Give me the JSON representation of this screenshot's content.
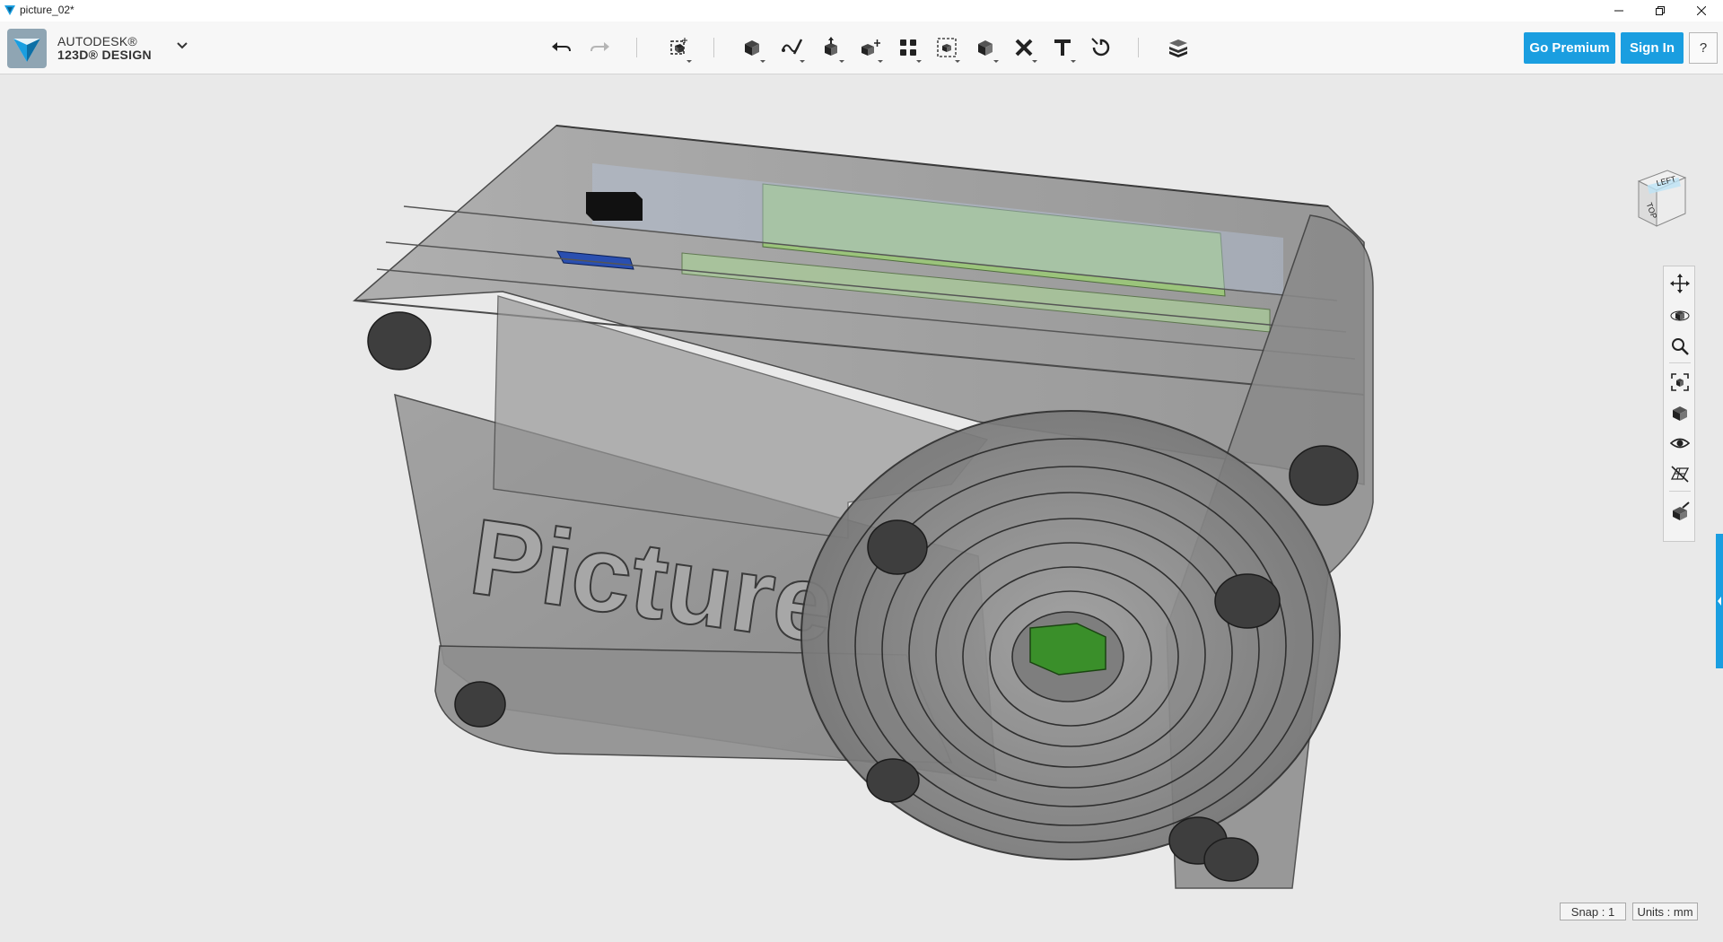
{
  "window": {
    "title": "picture_02*"
  },
  "brand": {
    "line1": "AUTODESK®",
    "line2": "123D® DESIGN"
  },
  "toolbar": {
    "tools": [
      {
        "name": "undo-icon"
      },
      {
        "name": "redo-icon"
      },
      {
        "name": "transform-icon"
      },
      {
        "name": "primitives-icon"
      },
      {
        "name": "sketch-icon"
      },
      {
        "name": "construct-icon"
      },
      {
        "name": "modify-icon"
      },
      {
        "name": "pattern-icon"
      },
      {
        "name": "group-icon"
      },
      {
        "name": "combine-icon"
      },
      {
        "name": "measure-icon"
      },
      {
        "name": "text-icon"
      },
      {
        "name": "snap-icon"
      },
      {
        "name": "material-icon"
      }
    ]
  },
  "buttons": {
    "premium": "Go Premium",
    "signin": "Sign In",
    "help": "?"
  },
  "viewcube": {
    "faces": [
      "LEFT",
      "TOP"
    ]
  },
  "model": {
    "text": "Picture",
    "accent_colors": {
      "pcb_green": "#9bc47b",
      "blue_part": "#2a4fb0",
      "lens_green": "#3a8f2a",
      "body_gray": "#8d8d8d"
    }
  },
  "status": {
    "snap": "Snap : 1",
    "units": "Units : mm"
  },
  "colors": {
    "accent": "#1a9ee0",
    "background": "#e9e9e9"
  }
}
